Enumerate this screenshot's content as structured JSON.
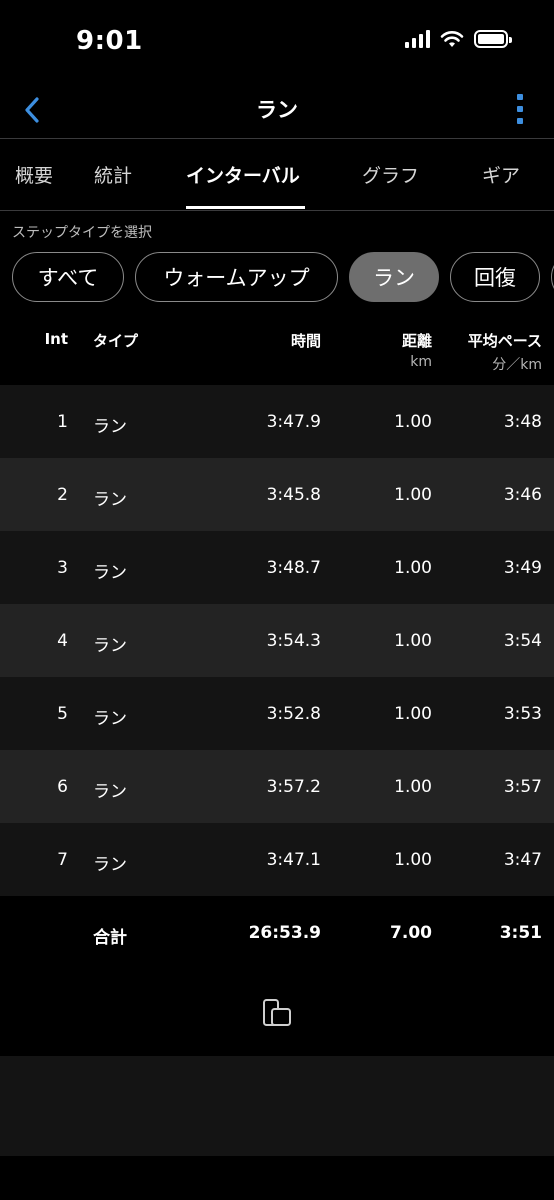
{
  "status_bar": {
    "time": "9:01"
  },
  "nav": {
    "title": "ラン"
  },
  "tabs": [
    {
      "label": "概要"
    },
    {
      "label": "統計"
    },
    {
      "label": "インターバル"
    },
    {
      "label": "グラフ"
    },
    {
      "label": "ギア"
    }
  ],
  "active_tab": "インターバル",
  "step_type": {
    "label": "ステップタイプを選択",
    "chips": [
      {
        "label": "すべて"
      },
      {
        "label": "ウォームアップ"
      },
      {
        "label": "ラン"
      },
      {
        "label": "回復"
      }
    ],
    "selected": "ラン"
  },
  "table": {
    "headers": {
      "int": "Int",
      "type": "タイプ",
      "time": "時間",
      "distance": "距離",
      "distance_unit": "km",
      "pace": "平均ペース",
      "pace_unit": "分／km"
    },
    "rows": [
      {
        "int": "1",
        "type": "ラン",
        "time": "3:47.9",
        "distance": "1.00",
        "pace": "3:48"
      },
      {
        "int": "2",
        "type": "ラン",
        "time": "3:45.8",
        "distance": "1.00",
        "pace": "3:46"
      },
      {
        "int": "3",
        "type": "ラン",
        "time": "3:48.7",
        "distance": "1.00",
        "pace": "3:49"
      },
      {
        "int": "4",
        "type": "ラン",
        "time": "3:54.3",
        "distance": "1.00",
        "pace": "3:54"
      },
      {
        "int": "5",
        "type": "ラン",
        "time": "3:52.8",
        "distance": "1.00",
        "pace": "3:53"
      },
      {
        "int": "6",
        "type": "ラン",
        "time": "3:57.2",
        "distance": "1.00",
        "pace": "3:57"
      },
      {
        "int": "7",
        "type": "ラン",
        "time": "3:47.1",
        "distance": "1.00",
        "pace": "3:47"
      }
    ],
    "total": {
      "label": "合計",
      "time": "26:53.9",
      "distance": "7.00",
      "pace": "3:51"
    }
  },
  "icons": {
    "back": "chevron-left-icon",
    "more": "vertical-ellipsis-icon",
    "device": "phone-device-icon"
  },
  "colors": {
    "accent": "#3d8fe0",
    "selected_chip": "#6e6e6e"
  }
}
